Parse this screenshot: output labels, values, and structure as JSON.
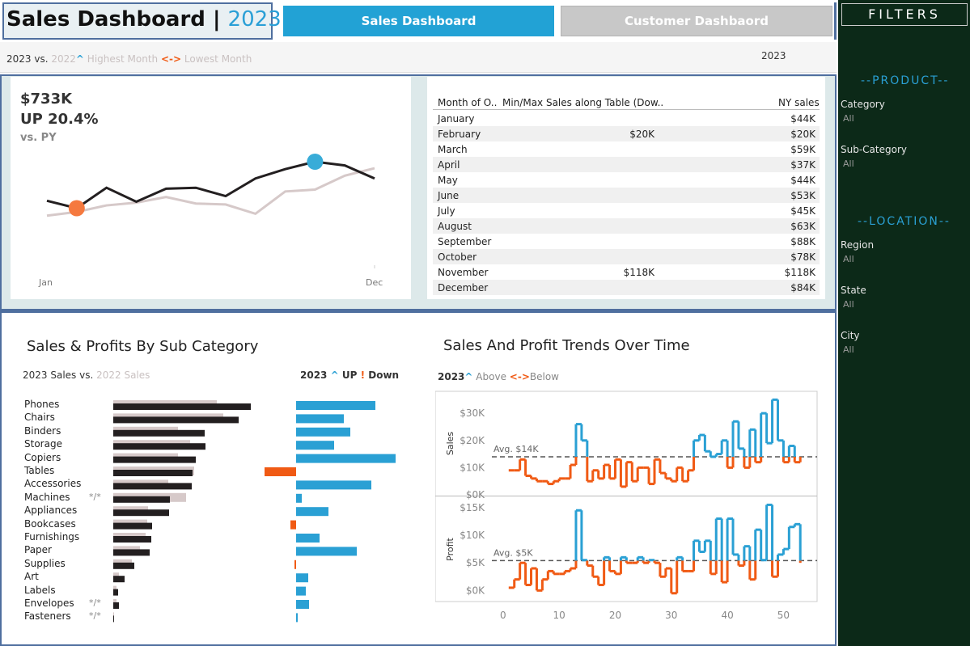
{
  "header": {
    "title": "Sales Dashboard",
    "separator": "|",
    "year": "2023",
    "tabs": [
      {
        "label": "Sales Dashboard",
        "active": true
      },
      {
        "label": "Customer Dashbaord",
        "active": false
      }
    ]
  },
  "legend": {
    "current": "2023 vs.",
    "prior": "2022",
    "highest_glyph": "^",
    "highest_label": "Highest Month",
    "lowest_glyph": "<->",
    "lowest_label": "Lowest Month",
    "year_filter": "2023"
  },
  "kpi": {
    "value": "$733K",
    "change": "UP 20.4%",
    "comparison": "vs. PY",
    "start_label": "Jan",
    "end_label": "Dec",
    "sparkline_current": [
      0.58,
      0.5,
      0.72,
      0.57,
      0.71,
      0.72,
      0.63,
      0.82,
      0.92,
      1.0,
      0.96,
      0.82
    ],
    "sparkline_prior": [
      0.42,
      0.46,
      0.53,
      0.56,
      0.62,
      0.55,
      0.54,
      0.44,
      0.68,
      0.7,
      0.85,
      0.93
    ]
  },
  "month_table": {
    "headers": [
      "Month of O..",
      "Min/Max Sales along Table (Dow..",
      "NY sales"
    ],
    "rows": [
      {
        "month": "January",
        "minmax": "",
        "ny": "$44K"
      },
      {
        "month": "February",
        "minmax": "$20K",
        "ny": "$20K"
      },
      {
        "month": "March",
        "minmax": "",
        "ny": "$59K"
      },
      {
        "month": "April",
        "minmax": "",
        "ny": "$37K"
      },
      {
        "month": "May",
        "minmax": "",
        "ny": "$44K"
      },
      {
        "month": "June",
        "minmax": "",
        "ny": "$53K"
      },
      {
        "month": "July",
        "minmax": "",
        "ny": "$45K"
      },
      {
        "month": "August",
        "minmax": "",
        "ny": "$63K"
      },
      {
        "month": "September",
        "minmax": "",
        "ny": "$88K"
      },
      {
        "month": "October",
        "minmax": "",
        "ny": "$78K"
      },
      {
        "month": "November",
        "minmax": "$118K",
        "ny": "$118K"
      },
      {
        "month": "December",
        "minmax": "",
        "ny": "$84K"
      }
    ]
  },
  "subcategory": {
    "title": "Sales & Profits By Sub Category",
    "legend_current": "2023 Sales vs.",
    "legend_prior": "2022 Sales",
    "updown_year": "2023",
    "updown_up_glyph": "^",
    "updown_up": "UP",
    "updown_down_glyph": "!",
    "updown_down": "Down",
    "note_glyph": "*/*",
    "colors": {
      "current": "#231f20",
      "prior": "#d6c9c9",
      "up": "#2aa0d4",
      "down": "#f05a14"
    }
  },
  "chart_data": [
    {
      "type": "bar",
      "categories": [
        "Phones",
        "Chairs",
        "Binders",
        "Storage",
        "Copiers",
        "Tables",
        "Accessories",
        "Machines",
        "Appliances",
        "Bookcases",
        "Furnishings",
        "Paper",
        "Supplies",
        "Art",
        "Labels",
        "Envelopes",
        "Fasteners"
      ],
      "notes": {
        "Machines": "*/*",
        "Envelopes": "*/*",
        "Fasteners": "*/*"
      },
      "series": [
        {
          "name": "2023 Sales",
          "values": [
            170,
            155,
            113,
            114,
            102,
            98,
            97,
            70,
            69,
            48,
            47,
            45,
            26,
            14,
            6,
            7,
            1
          ]
        },
        {
          "name": "2022 Sales",
          "values": [
            128,
            136,
            80,
            95,
            80,
            100,
            68,
            90,
            43,
            42,
            40,
            33,
            23,
            7,
            4,
            4,
            1
          ]
        }
      ],
      "title": "Sales & Profits By Sub Category"
    },
    {
      "type": "bar",
      "categories": [
        "Phones",
        "Chairs",
        "Binders",
        "Storage",
        "Copiers",
        "Tables",
        "Accessories",
        "Machines",
        "Appliances",
        "Bookcases",
        "Furnishings",
        "Paper",
        "Supplies",
        "Art",
        "Labels",
        "Envelopes",
        "Fasteners"
      ],
      "series": [
        {
          "name": "Profit change",
          "values": [
            98,
            59,
            67,
            47,
            123,
            -39,
            93,
            7,
            40,
            -7,
            29,
            75,
            -2,
            15,
            12,
            16,
            2
          ]
        }
      ]
    },
    {
      "type": "line",
      "title": "Sales And Profit Trends Over Time",
      "panels": [
        {
          "ylabel": "Sales",
          "yticks": [
            "$0K",
            "$10K",
            "$20K",
            "$30K"
          ],
          "ylim": [
            0,
            36
          ],
          "avg_label": "Avg. $14K",
          "avg": 14,
          "x": [
            1,
            2,
            3,
            4,
            5,
            6,
            7,
            8,
            9,
            10,
            11,
            12,
            13,
            14,
            15,
            16,
            17,
            18,
            19,
            20,
            21,
            22,
            23,
            24,
            25,
            26,
            27,
            28,
            29,
            30,
            31,
            32,
            33,
            34,
            35,
            36,
            37,
            38,
            39,
            40,
            41,
            42,
            43,
            44,
            45,
            46,
            47,
            48,
            49,
            50,
            51,
            52,
            53
          ],
          "values": [
            9,
            9,
            13,
            7,
            6,
            5,
            5,
            4,
            5,
            6,
            6,
            11,
            26,
            20,
            5,
            9,
            6,
            11,
            6,
            13,
            3,
            12,
            5,
            10,
            10,
            4,
            13,
            8,
            6,
            5,
            10,
            5,
            9,
            20,
            22,
            16,
            14,
            15,
            20,
            10,
            27,
            17,
            10,
            24,
            12,
            30,
            19,
            35,
            20,
            12,
            18,
            12,
            14
          ]
        },
        {
          "ylabel": "Profit",
          "yticks": [
            "$0K",
            "$5K",
            "$10K",
            "$15K"
          ],
          "ylim": [
            -2,
            16
          ],
          "avg_label": "Avg. $5K",
          "avg": 5.4,
          "x": [
            1,
            2,
            3,
            4,
            5,
            6,
            7,
            8,
            9,
            10,
            11,
            12,
            13,
            14,
            15,
            16,
            17,
            18,
            19,
            20,
            21,
            22,
            23,
            24,
            25,
            26,
            27,
            28,
            29,
            30,
            31,
            32,
            33,
            34,
            35,
            36,
            37,
            38,
            39,
            40,
            41,
            42,
            43,
            44,
            45,
            46,
            47,
            48,
            49,
            50,
            51,
            52,
            53
          ],
          "values": [
            0.5,
            2,
            5,
            1,
            4,
            0,
            2,
            3.5,
            3,
            3,
            3.5,
            4,
            14.5,
            5.5,
            4.5,
            2.5,
            1,
            6,
            3.5,
            3,
            6,
            5,
            5,
            6,
            5,
            5.5,
            5,
            2.5,
            4,
            -0.5,
            6,
            3.5,
            3.5,
            9,
            7,
            9,
            3,
            13,
            1.5,
            13,
            6.5,
            4.5,
            8,
            2,
            11,
            5.5,
            15.5,
            2.5,
            6.5,
            7.5,
            11.5,
            12,
            5
          ]
        }
      ],
      "xticks": [
        "0",
        "10",
        "20",
        "30",
        "40",
        "50"
      ],
      "xlim": [
        -2,
        56
      ]
    }
  ],
  "trend": {
    "title": "Sales And Profit Trends Over Time",
    "legend_year": "2023",
    "above_glyph": "^",
    "above_label": "Above",
    "below_glyph": "<->",
    "below_label": "Below",
    "colors": {
      "above": "#2aa0d4",
      "below": "#f05a14"
    }
  },
  "filters": {
    "title": "FILTERS",
    "product_heading": "--PRODUCT--",
    "location_heading": "--LOCATION--",
    "items": [
      {
        "label": "Category",
        "value": "All"
      },
      {
        "label": "Sub-Category",
        "value": "All"
      },
      {
        "label": "Region",
        "value": "All"
      },
      {
        "label": "State",
        "value": "All"
      },
      {
        "label": "City",
        "value": "All"
      }
    ]
  }
}
